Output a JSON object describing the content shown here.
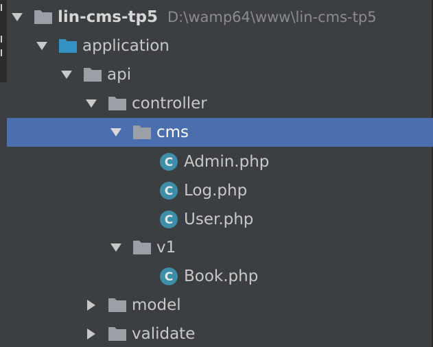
{
  "tree": {
    "rows": [
      {
        "label": "lin-cms-tp5",
        "path": "D:\\wamp64\\www\\lin-cms-tp5",
        "expanded": true,
        "kind": "project-folder"
      },
      {
        "label": "application",
        "expanded": true,
        "kind": "module-folder"
      },
      {
        "label": "api",
        "expanded": true,
        "kind": "folder"
      },
      {
        "label": "controller",
        "expanded": true,
        "kind": "folder"
      },
      {
        "label": "cms",
        "expanded": true,
        "kind": "folder",
        "selected": true
      },
      {
        "label": "Admin.php",
        "kind": "class-file",
        "badge": "C"
      },
      {
        "label": "Log.php",
        "kind": "class-file",
        "badge": "C"
      },
      {
        "label": "User.php",
        "kind": "class-file",
        "badge": "C"
      },
      {
        "label": "v1",
        "expanded": true,
        "kind": "folder"
      },
      {
        "label": "Book.php",
        "kind": "class-file",
        "badge": "C"
      },
      {
        "label": "model",
        "expanded": false,
        "kind": "folder"
      },
      {
        "label": "validate",
        "expanded": false,
        "kind": "folder"
      }
    ]
  },
  "colors": {
    "background": "#3c3f41",
    "selection": "#4b6eaf",
    "folder": "#9aa0a6",
    "module_folder": "#3592c4",
    "class_badge": "#3d8ea8",
    "text": "#c8c8c8",
    "path_text": "#8c8c8c"
  }
}
